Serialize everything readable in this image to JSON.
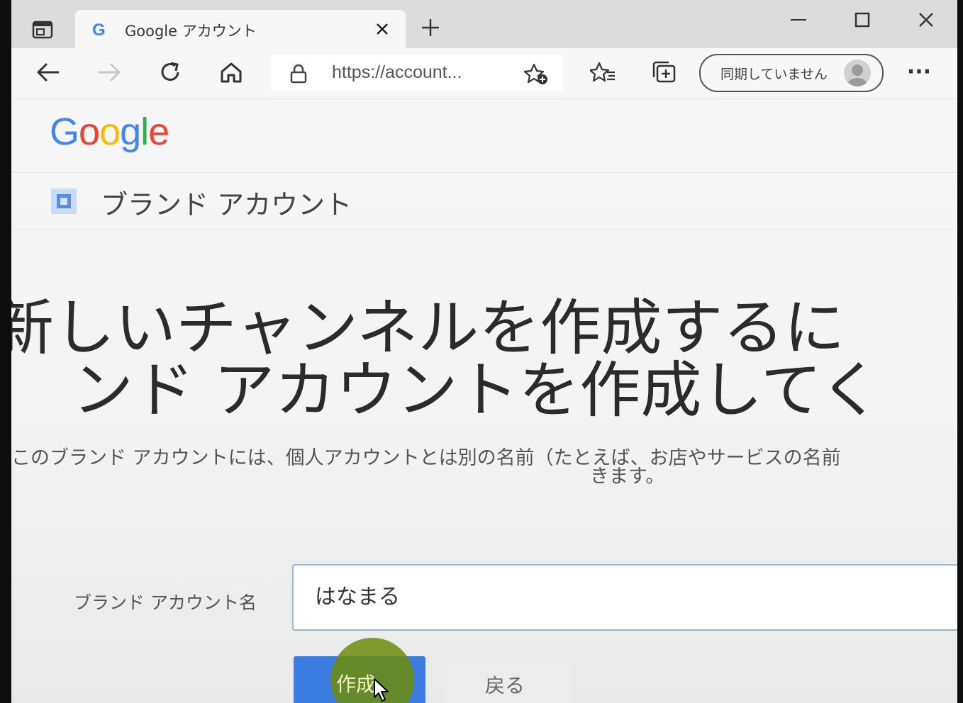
{
  "browser": {
    "tab": {
      "title": "Google アカウント"
    },
    "address_bar": {
      "url": "https://account..."
    },
    "sync_button": {
      "label": "同期していません"
    },
    "more_menu_label": "···"
  },
  "page": {
    "logo_text": {
      "G": "G",
      "o1": "o",
      "o2": "o",
      "g": "g",
      "l": "l",
      "e": "e"
    },
    "brand_header": "ブランド アカウント",
    "headline_line1": "新しいチャンネルを作成するに",
    "headline_line2": "ンド アカウントを作成してく",
    "description_line1": "このブランド アカウントには、個人アカウントとは別の名前（たとえば、お店やサービスの名前",
    "description_line2": "きます。",
    "form": {
      "label": "ブランド アカウント名",
      "value": "はなまる"
    },
    "buttons": {
      "create": "作成",
      "back": "戻る"
    }
  },
  "colors": {
    "google_blue": "#4285F4",
    "google_red": "#EA4335",
    "google_yellow": "#FBBC05",
    "google_green": "#34A853",
    "primary_button": "#3b7de0"
  }
}
